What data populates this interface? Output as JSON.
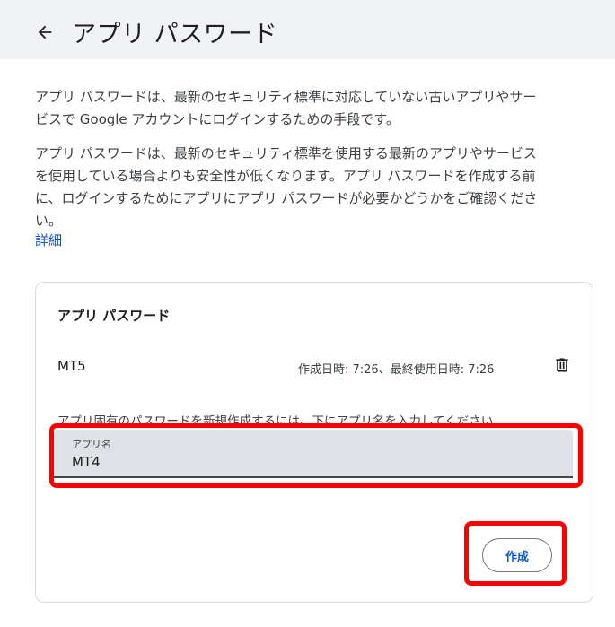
{
  "header": {
    "title": "アプリ パスワード",
    "back_icon": "arrow-left-icon"
  },
  "intro": {
    "paragraph1": "アプリ パスワードは、最新のセキュリティ標準に対応していない古いアプリやサービスで Google アカウントにログインするための手段です。",
    "paragraph2": "アプリ パスワードは、最新のセキュリティ標準を使用する最新のアプリやサービスを使用している場合よりも安全性が低くなります。アプリ パスワードを作成する前に、ログインするためにアプリにアプリ パスワードが必要かどうかをご確認ください。",
    "learn_more": "詳細"
  },
  "card": {
    "title": "アプリ パスワード",
    "passwords": [
      {
        "name": "MT5",
        "meta": "作成日時: 7:26、最終使用日時: 7:26",
        "delete_icon": "trash-icon"
      }
    ],
    "instruction": "アプリ固有のパスワードを新規作成するには、下にアプリ名を入力してください...",
    "field": {
      "label": "アプリ名",
      "value": "MT4"
    },
    "create_label": "作成"
  },
  "colors": {
    "header_bg": "#f0f2f6",
    "link": "#0b57d0",
    "field_bg": "#dfe3e7",
    "highlight": "#ff0000"
  }
}
